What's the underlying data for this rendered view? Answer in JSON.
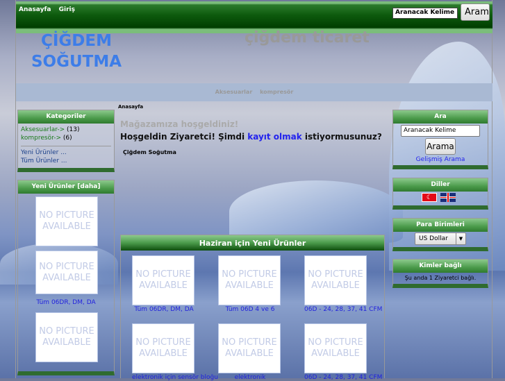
{
  "topbar": {
    "links": [
      "Anasayfa",
      "Giriş"
    ],
    "search_value": "Aranacak Kelime",
    "search_button": "Aram"
  },
  "header": {
    "logo_line1": "ÇİĞDEM",
    "logo_line2": "SOĞUTMA",
    "store_name": "çiğdem ticaret"
  },
  "nav": {
    "items": [
      "Aksesuarlar",
      "kompresör"
    ]
  },
  "breadcrumb": "Anasayfa",
  "left": {
    "categories": {
      "title": "Kategoriler",
      "items": [
        {
          "label": "Aksesuarlar->",
          "count": "(13)"
        },
        {
          "label": "kompresör->",
          "count": "(6)"
        }
      ],
      "links": [
        "Yeni Ürünler ...",
        "Tüm Ürünler ..."
      ]
    },
    "new_products": {
      "title": "Yeni Ürünler  [daha]",
      "items": [
        {
          "image": "NO PICTURE AVAILABLE",
          "name": ""
        },
        {
          "image": "NO PICTURE AVAILABLE",
          "name": "Tüm 06DR, DM, DA"
        },
        {
          "image": "NO PICTURE AVAILABLE",
          "name": ""
        }
      ]
    }
  },
  "main": {
    "welcome": "Mağazamıza hoşgeldiniz!",
    "greeting_pre": "Hoşgeldin Ziyaretci! Şimdi ",
    "greeting_link": "kayıt olmak",
    "greeting_post": " istiyormusunuz?",
    "subtitle": "Çiğdem Soğutma",
    "new_month": {
      "title": "Haziran için Yeni Ürünler",
      "no_picture": "NO PICTURE AVAILABLE",
      "products": [
        "Tüm 06DR, DM, DA",
        "Tüm 06D 4 ve 6",
        "06D - 24, 28, 37, 41 CFM",
        "elektronik için sensör bloğu",
        "elektronik",
        "06D - 24, 28, 37, 41 CFM"
      ]
    }
  },
  "right": {
    "search": {
      "title": "Ara",
      "value": "Aranacak Kelime",
      "button": "Arama",
      "advanced": "Gelişmiş Arama"
    },
    "languages": {
      "title": "Diller"
    },
    "currency": {
      "title": "Para Birimleri",
      "selected": "US Dollar"
    },
    "online": {
      "title": "Kimler bağlı",
      "text": "Şu anda 1 Ziyaretci bağlı."
    }
  }
}
